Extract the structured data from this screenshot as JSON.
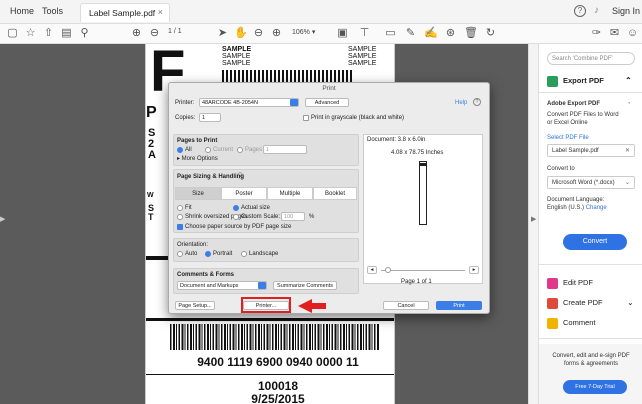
{
  "topbar": {
    "home": "Home",
    "tools": "Tools",
    "doc_tab": "Label Sample.pdf",
    "close_tab": "×",
    "sign_in": "Sign In"
  },
  "toolbar": {
    "page_current": "1",
    "page_total": "/ 1",
    "zoom": "106%"
  },
  "label": {
    "big_letter": "F",
    "sample_left": [
      "SAMPLE",
      "SAMPLE",
      "SAMPLE"
    ],
    "sample_right": [
      "SAMPLE",
      "SAMPLE",
      "SAMPLE"
    ],
    "left_chars_a": "P",
    "left_chars_b": [
      "S",
      "2",
      "A"
    ],
    "left_chars_c": [
      "W"
    ],
    "left_chars_d": [
      "S",
      "T"
    ],
    "tracking": "9400 1119 6900 0940 0000 11",
    "zip": "100018",
    "date": "9/25/2015"
  },
  "dialog": {
    "title": "Print",
    "printer_label": "Printer:",
    "printer_value": "48ARCODE 4B-2054N",
    "advanced": "Advanced",
    "help": "Help",
    "copies_label": "Copies:",
    "copies_value": "1",
    "grayscale": "Print in grayscale (black and white)",
    "pages_to_print": "Pages to Print",
    "opt_all": "All",
    "opt_current": "Current",
    "opt_pages": "Pages",
    "pages_value": "1",
    "more_options": "▸ More Options",
    "page_sizing": "Page Sizing & Handling",
    "info_icon": "ⓘ",
    "seg_size": "Size",
    "seg_poster": "Poster",
    "seg_multiple": "Multiple",
    "seg_booklet": "Booklet",
    "fit": "Fit",
    "actual_size": "Actual size",
    "shrink": "Shrink oversized pages",
    "custom_scale": "Custom Scale:",
    "custom_scale_value": "100",
    "percent": "%",
    "paper_source": "Choose paper source by PDF page size",
    "orientation_label": "Orientation:",
    "auto": "Auto",
    "portrait": "Portrait",
    "landscape": "Landscape",
    "comments_forms": "Comments & Forms",
    "comments_value": "Document and Markups",
    "summarize": "Summarize Comments",
    "document_size": "Document: 3.8 x 6.0in",
    "preview_size": "4.08 x 78.75 Inches",
    "page_of": "Page 1 of 1",
    "page_setup": "Page Setup...",
    "printer_btn": "Printer...",
    "cancel": "Cancel",
    "print": "Print"
  },
  "right_panel": {
    "search_placeholder": "Search 'Combine PDF'",
    "export_pdf": "Export PDF",
    "adobe_export_title": "Adobe Export PDF",
    "adobe_export_desc_1": "Convert PDF Files to Word",
    "adobe_export_desc_2": "or Excel Online",
    "select_pdf": "Select PDF File",
    "file_name": "Label Sample.pdf",
    "convert_to": "Convert to",
    "convert_format": "Microsoft Word (*.docx)",
    "doc_language": "Document Language:",
    "language": "English (U.S.)",
    "change": "Change",
    "convert_btn": "Convert",
    "edit_pdf": "Edit PDF",
    "create_pdf": "Create PDF",
    "comment": "Comment",
    "promo_1": "Convert, edit and e-sign PDF",
    "promo_2": "forms & agreements",
    "trial_btn": "Free 7-Day Trial"
  },
  "colors": {
    "accent": "#3b7ee6",
    "highlight": "#e02020",
    "viewer_bg": "#5b5b5b"
  }
}
